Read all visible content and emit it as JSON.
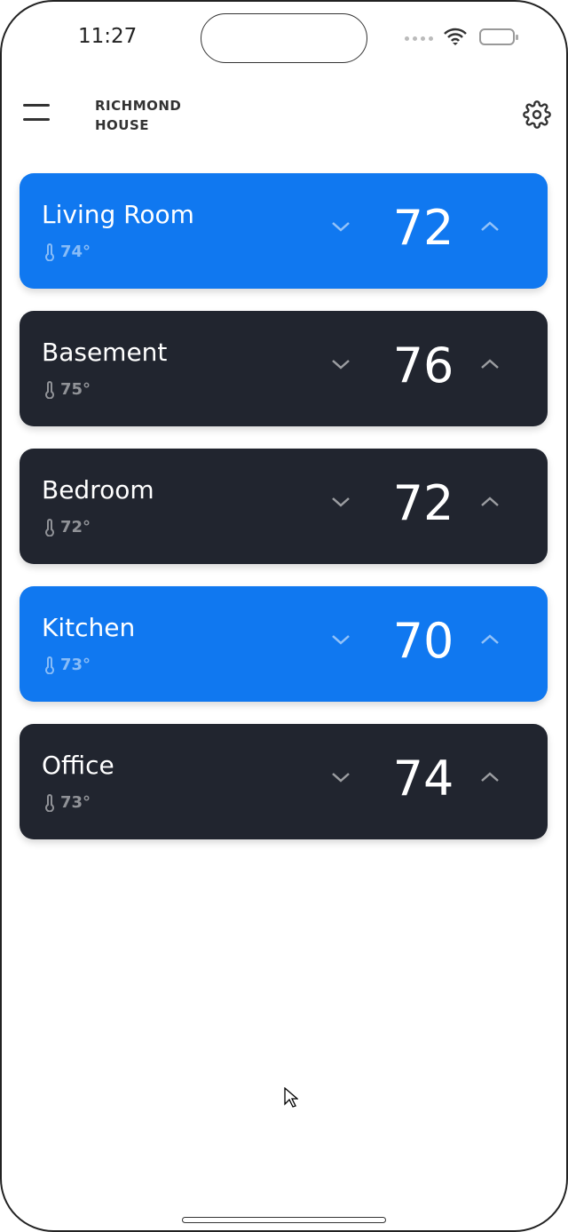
{
  "status_bar": {
    "time": "11:27"
  },
  "header": {
    "title_line1": "RICHMOND",
    "title_line2": "HOUSE",
    "menu_icon": "hamburger-icon",
    "settings_icon": "gear-icon"
  },
  "colors": {
    "active": "#1078f0",
    "inactive": "#21252f"
  },
  "rooms": [
    {
      "name": "Living Room",
      "current": "74°",
      "setpoint": "72",
      "active": true
    },
    {
      "name": "Basement",
      "current": "75°",
      "setpoint": "76",
      "active": false
    },
    {
      "name": "Bedroom",
      "current": "72°",
      "setpoint": "72",
      "active": false
    },
    {
      "name": "Kitchen",
      "current": "73°",
      "setpoint": "70",
      "active": true
    },
    {
      "name": "Office",
      "current": "73°",
      "setpoint": "74",
      "active": false
    }
  ]
}
